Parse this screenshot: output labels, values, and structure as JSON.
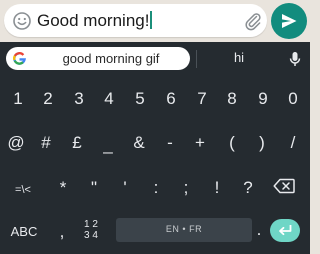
{
  "compose": {
    "message_text": "Good morning!",
    "emoji_icon": "smiley-icon",
    "attach_icon": "paperclip-icon",
    "send_icon": "send-arrow-icon",
    "send_color": "#128c7e"
  },
  "keyboard": {
    "suggestions": {
      "search_text": "good morning gif",
      "word_suggestion": "hi",
      "google_icon": "google-g-icon",
      "mic_icon": "microphone-icon"
    },
    "row1": [
      "1",
      "2",
      "3",
      "4",
      "5",
      "6",
      "7",
      "8",
      "9",
      "0"
    ],
    "row2": [
      "@",
      "#",
      "£",
      "_",
      "&",
      "-",
      "+",
      "(",
      ")",
      "/"
    ],
    "row3": [
      "=\\<",
      "*",
      "\"",
      "'",
      ":",
      ";",
      "!",
      "?"
    ],
    "row4": {
      "abc_label": "ABC",
      "comma": ",",
      "numpad_top": "1 2",
      "numpad_bottom": "3 4",
      "space_label": "EN • FR",
      "period": "."
    },
    "backspace_icon": "backspace-icon",
    "enter_icon": "enter-arrow-icon",
    "enter_color": "#6fd6c6"
  }
}
